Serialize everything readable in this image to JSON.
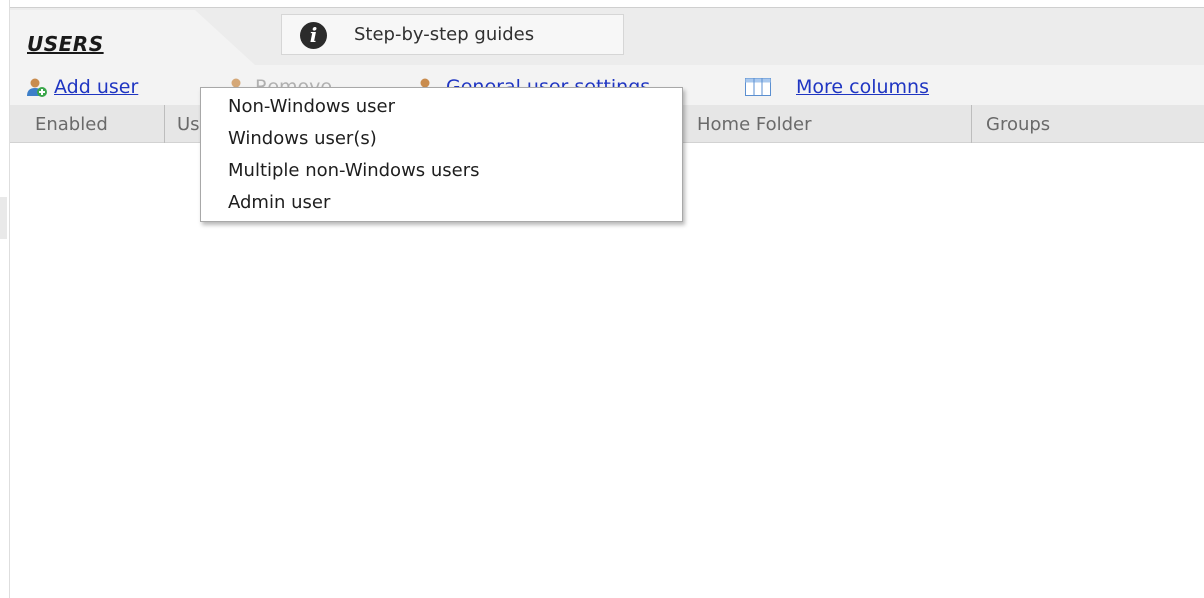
{
  "tabs": {
    "users_label": "USERS",
    "guides_label": "Step-by-step guides",
    "guides_icon": "info-icon"
  },
  "toolbar": {
    "add_user_label": "Add user",
    "add_user_icon": "add-user-icon",
    "remove_label": "Remove",
    "remove_icon": "remove-user-icon",
    "settings_label": "General user settings",
    "settings_icon": "user-settings-icon",
    "columns_label": "More columns",
    "columns_icon": "columns-icon",
    "link_color": "#1f35c2"
  },
  "table": {
    "columns": [
      "Enabled",
      "Username",
      "Home Folder",
      "Groups"
    ]
  },
  "add_user_menu": {
    "items": [
      "Non-Windows user",
      "Windows user(s)",
      "Multiple non-Windows users",
      "Admin user"
    ]
  }
}
